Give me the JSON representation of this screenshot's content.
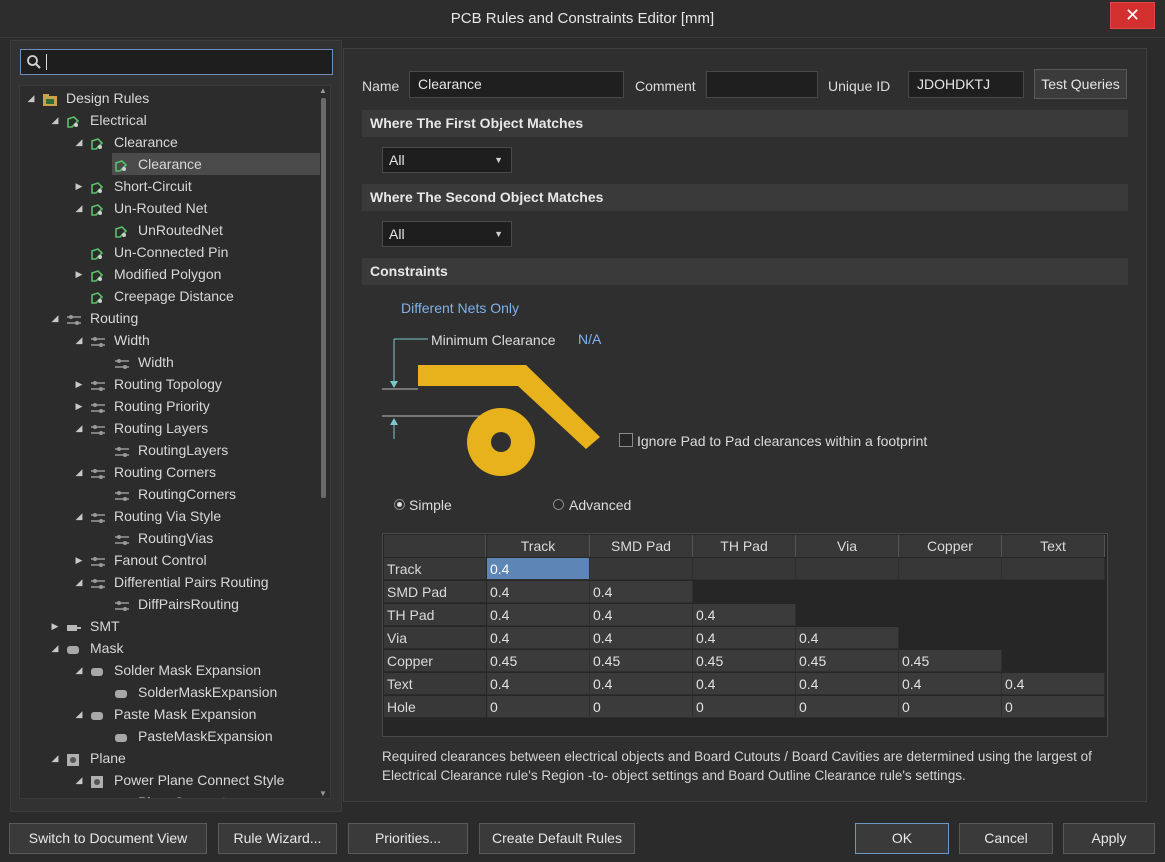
{
  "window": {
    "title": "PCB Rules and Constraints Editor [mm]",
    "close_glyph": "✕"
  },
  "search": {
    "value": "",
    "placeholder": ""
  },
  "tree": [
    {
      "label": "Design Rules",
      "depth": 0,
      "arrow": "◢",
      "icon": "design-rules-icon",
      "selected": false
    },
    {
      "label": "Electrical",
      "depth": 1,
      "arrow": "◢",
      "icon": "electrical-icon",
      "selected": false
    },
    {
      "label": "Clearance",
      "depth": 2,
      "arrow": "◢",
      "icon": "electrical-icon",
      "selected": false
    },
    {
      "label": "Clearance",
      "depth": 3,
      "arrow": "",
      "icon": "electrical-icon",
      "selected": true
    },
    {
      "label": "Short-Circuit",
      "depth": 2,
      "arrow": "▶",
      "icon": "electrical-icon",
      "selected": false
    },
    {
      "label": "Un-Routed Net",
      "depth": 2,
      "arrow": "◢",
      "icon": "electrical-icon",
      "selected": false
    },
    {
      "label": "UnRoutedNet",
      "depth": 3,
      "arrow": "",
      "icon": "electrical-icon",
      "selected": false
    },
    {
      "label": "Un-Connected Pin",
      "depth": 2,
      "arrow": "",
      "icon": "electrical-icon",
      "selected": false
    },
    {
      "label": "Modified Polygon",
      "depth": 2,
      "arrow": "▶",
      "icon": "electrical-icon",
      "selected": false
    },
    {
      "label": "Creepage Distance",
      "depth": 2,
      "arrow": "",
      "icon": "electrical-icon",
      "selected": false
    },
    {
      "label": "Routing",
      "depth": 1,
      "arrow": "◢",
      "icon": "routing-icon",
      "selected": false
    },
    {
      "label": "Width",
      "depth": 2,
      "arrow": "◢",
      "icon": "routing-icon",
      "selected": false
    },
    {
      "label": "Width",
      "depth": 3,
      "arrow": "",
      "icon": "routing-icon",
      "selected": false
    },
    {
      "label": "Routing Topology",
      "depth": 2,
      "arrow": "▶",
      "icon": "routing-icon",
      "selected": false
    },
    {
      "label": "Routing Priority",
      "depth": 2,
      "arrow": "▶",
      "icon": "routing-icon",
      "selected": false
    },
    {
      "label": "Routing Layers",
      "depth": 2,
      "arrow": "◢",
      "icon": "routing-icon",
      "selected": false
    },
    {
      "label": "RoutingLayers",
      "depth": 3,
      "arrow": "",
      "icon": "routing-icon",
      "selected": false
    },
    {
      "label": "Routing Corners",
      "depth": 2,
      "arrow": "◢",
      "icon": "routing-icon",
      "selected": false
    },
    {
      "label": "RoutingCorners",
      "depth": 3,
      "arrow": "",
      "icon": "routing-icon",
      "selected": false
    },
    {
      "label": "Routing Via Style",
      "depth": 2,
      "arrow": "◢",
      "icon": "routing-icon",
      "selected": false
    },
    {
      "label": "RoutingVias",
      "depth": 3,
      "arrow": "",
      "icon": "routing-icon",
      "selected": false
    },
    {
      "label": "Fanout Control",
      "depth": 2,
      "arrow": "▶",
      "icon": "routing-icon",
      "selected": false
    },
    {
      "label": "Differential Pairs Routing",
      "depth": 2,
      "arrow": "◢",
      "icon": "routing-icon",
      "selected": false
    },
    {
      "label": "DiffPairsRouting",
      "depth": 3,
      "arrow": "",
      "icon": "routing-icon",
      "selected": false
    },
    {
      "label": "SMT",
      "depth": 1,
      "arrow": "▶",
      "icon": "smt-icon",
      "selected": false
    },
    {
      "label": "Mask",
      "depth": 1,
      "arrow": "◢",
      "icon": "mask-icon",
      "selected": false
    },
    {
      "label": "Solder Mask Expansion",
      "depth": 2,
      "arrow": "◢",
      "icon": "mask-icon",
      "selected": false
    },
    {
      "label": "SolderMaskExpansion",
      "depth": 3,
      "arrow": "",
      "icon": "mask-icon",
      "selected": false
    },
    {
      "label": "Paste Mask Expansion",
      "depth": 2,
      "arrow": "◢",
      "icon": "mask-icon",
      "selected": false
    },
    {
      "label": "PasteMaskExpansion",
      "depth": 3,
      "arrow": "",
      "icon": "mask-icon",
      "selected": false
    },
    {
      "label": "Plane",
      "depth": 1,
      "arrow": "◢",
      "icon": "plane-icon",
      "selected": false
    },
    {
      "label": "Power Plane Connect Style",
      "depth": 2,
      "arrow": "◢",
      "icon": "plane-icon",
      "selected": false
    },
    {
      "label": "PlaneConnect",
      "depth": 3,
      "arrow": "",
      "icon": "plane-icon",
      "selected": false
    }
  ],
  "rule": {
    "name_label": "Name",
    "name_value": "Clearance",
    "comment_label": "Comment",
    "comment_value": "",
    "uid_label": "Unique ID",
    "uid_value": "JDOHDKTJ",
    "test_queries": "Test Queries"
  },
  "first_match": {
    "title": "Where The First Object Matches",
    "value": "All"
  },
  "second_match": {
    "title": "Where The Second Object Matches",
    "value": "All"
  },
  "constraints": {
    "title": "Constraints",
    "net_scope": "Different Nets Only",
    "min_clearance_label": "Minimum Clearance",
    "min_clearance_value": "N/A",
    "ignore_pad_label": "Ignore Pad to Pad clearances within a footprint",
    "ignore_pad_checked": false,
    "mode_simple": "Simple",
    "mode_advanced": "Advanced",
    "mode_selected": "Simple",
    "diagram_color": "#e8b21c",
    "grid_columns": [
      "Track",
      "SMD Pad",
      "TH Pad",
      "Via",
      "Copper",
      "Text"
    ],
    "grid_rows": [
      {
        "label": "Track",
        "values": [
          "0.4",
          "",
          "",
          "",
          "",
          ""
        ]
      },
      {
        "label": "SMD Pad",
        "values": [
          "0.4",
          "0.4"
        ]
      },
      {
        "label": "TH Pad",
        "values": [
          "0.4",
          "0.4",
          "0.4"
        ]
      },
      {
        "label": "Via",
        "values": [
          "0.4",
          "0.4",
          "0.4",
          "0.4"
        ]
      },
      {
        "label": "Copper",
        "values": [
          "0.45",
          "0.45",
          "0.45",
          "0.45",
          "0.45"
        ]
      },
      {
        "label": "Text",
        "values": [
          "0.4",
          "0.4",
          "0.4",
          "0.4",
          "0.4",
          "0.4"
        ]
      },
      {
        "label": "Hole",
        "values": [
          "0",
          "0",
          "0",
          "0",
          "0",
          "0"
        ]
      }
    ],
    "note": "Required clearances between electrical objects and Board Cutouts / Board Cavities are determined using the largest of Electrical Clearance rule's Region -to- object settings and Board Outline Clearance rule's settings."
  },
  "footer": {
    "switch_view": "Switch to Document View",
    "rule_wizard": "Rule Wizard...",
    "priorities": "Priorities...",
    "create_default": "Create Default Rules",
    "ok": "OK",
    "cancel": "Cancel",
    "apply": "Apply"
  }
}
